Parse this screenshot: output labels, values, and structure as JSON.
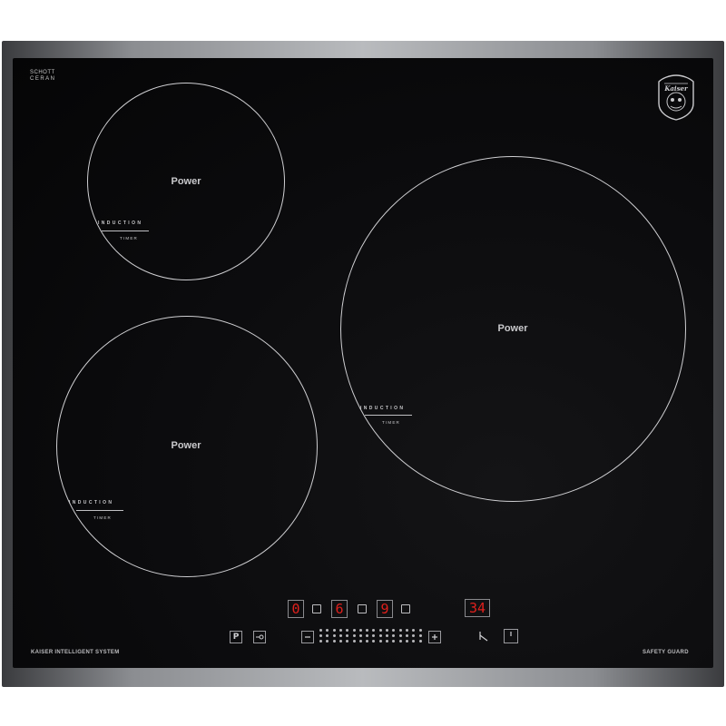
{
  "brand": {
    "line1": "SCHOTT",
    "line2": "CERAN"
  },
  "logo_text": "Kaiser",
  "zones": [
    {
      "id": "top-left",
      "label": "Power",
      "induction": "INDUCTION",
      "timer": "TIMER"
    },
    {
      "id": "bottom-left",
      "label": "Power",
      "induction": "INDUCTION",
      "timer": "TIMER"
    },
    {
      "id": "right",
      "label": "Power",
      "induction": "INDUCTION",
      "timer": "TIMER"
    }
  ],
  "display": {
    "digit1": "0",
    "digit2": "6",
    "digit3": "9",
    "timer_value": "34"
  },
  "controls": {
    "pause_label": "P",
    "lock_icon": "key-lock-icon",
    "minus_icon": "minus-icon",
    "plus_icon": "plus-icon",
    "clock_icon": "clock-icon",
    "power_icon": "power-icon"
  },
  "footer": {
    "left": "KAISER INTELLIGENT SYSTEM",
    "right": "SAFETY GUARD"
  },
  "colors": {
    "glass": "#0b0b0d",
    "frame": "#b9bbbe",
    "display_red": "#e0201c",
    "lines": "#cfcfd2"
  }
}
